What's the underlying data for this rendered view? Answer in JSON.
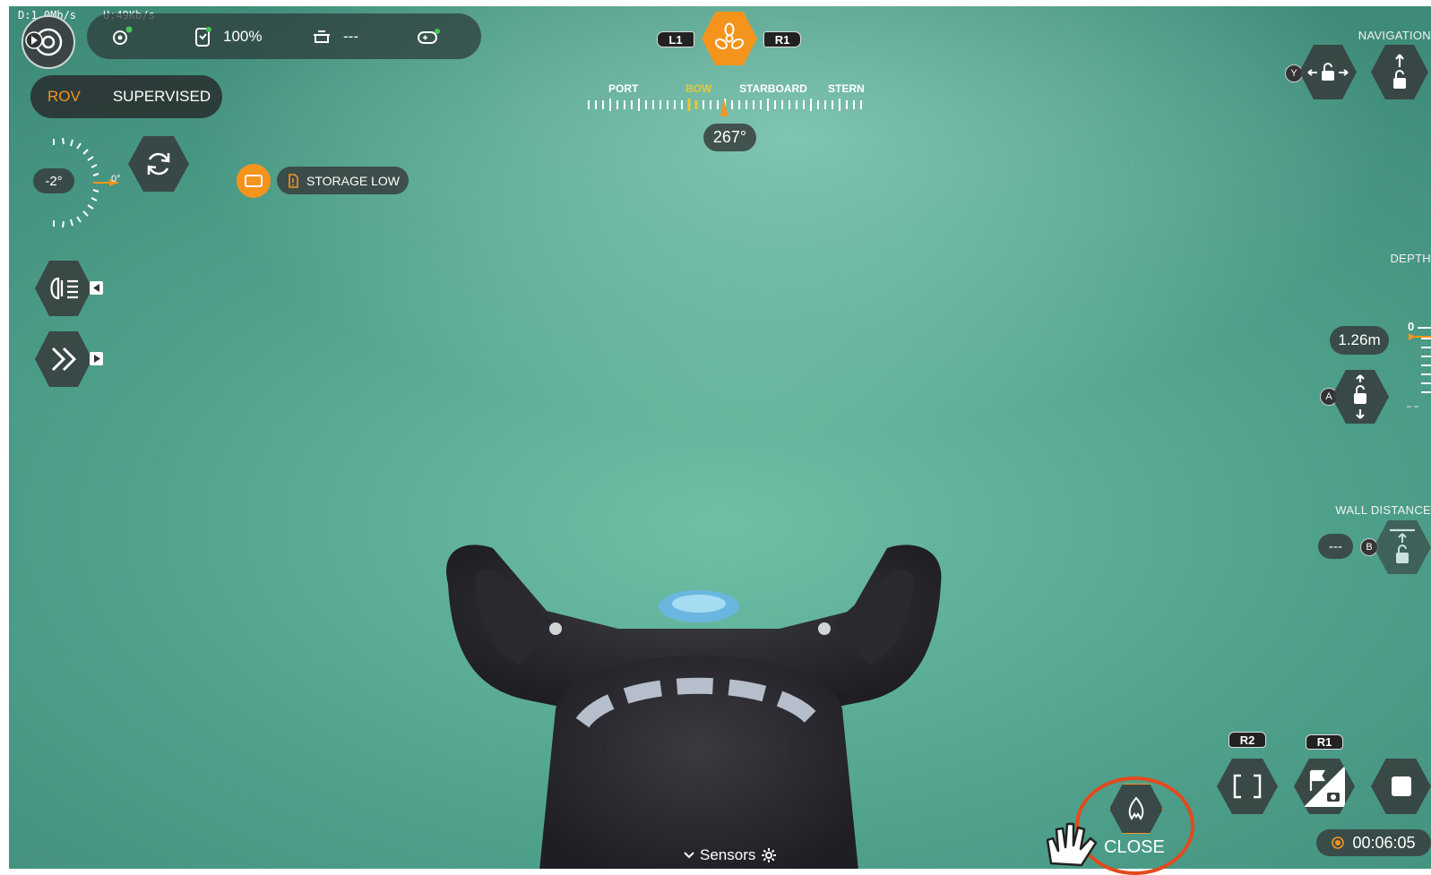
{
  "network": {
    "download": "D:1.0Mb/s",
    "upload": "U:49Kb/s"
  },
  "status_bar": {
    "battery_value": "100%",
    "tether_value": "---"
  },
  "mode_toggle": {
    "active": "ROV",
    "inactive": "SUPERVISED"
  },
  "thruster": {
    "left_button": "L1",
    "right_button": "R1"
  },
  "compass": {
    "labels": [
      "PORT",
      "BOW",
      "STARBOARD",
      "STERN"
    ],
    "heading": "267°"
  },
  "tilt": {
    "value": "-2°",
    "zero_label": "0°"
  },
  "storage_warning": "STORAGE LOW",
  "navigation": {
    "label": "NAVIGATION",
    "button_key": "Y"
  },
  "depth": {
    "label": "DEPTH",
    "value": "1.26m",
    "button_key": "A",
    "scale_zero": "0"
  },
  "wall_distance": {
    "label": "WALL DISTANCE",
    "value": "---",
    "button_key": "B"
  },
  "recording": {
    "r2_label": "R2",
    "r1_label": "R1",
    "timer": "00:06:05"
  },
  "gripper": {
    "close_label": "CLOSE"
  },
  "sensors": {
    "label": "Sensors"
  },
  "colors": {
    "accent_orange": "#f5941d",
    "panel": "#373e3e",
    "bow_yellow": "#e5c83a"
  }
}
